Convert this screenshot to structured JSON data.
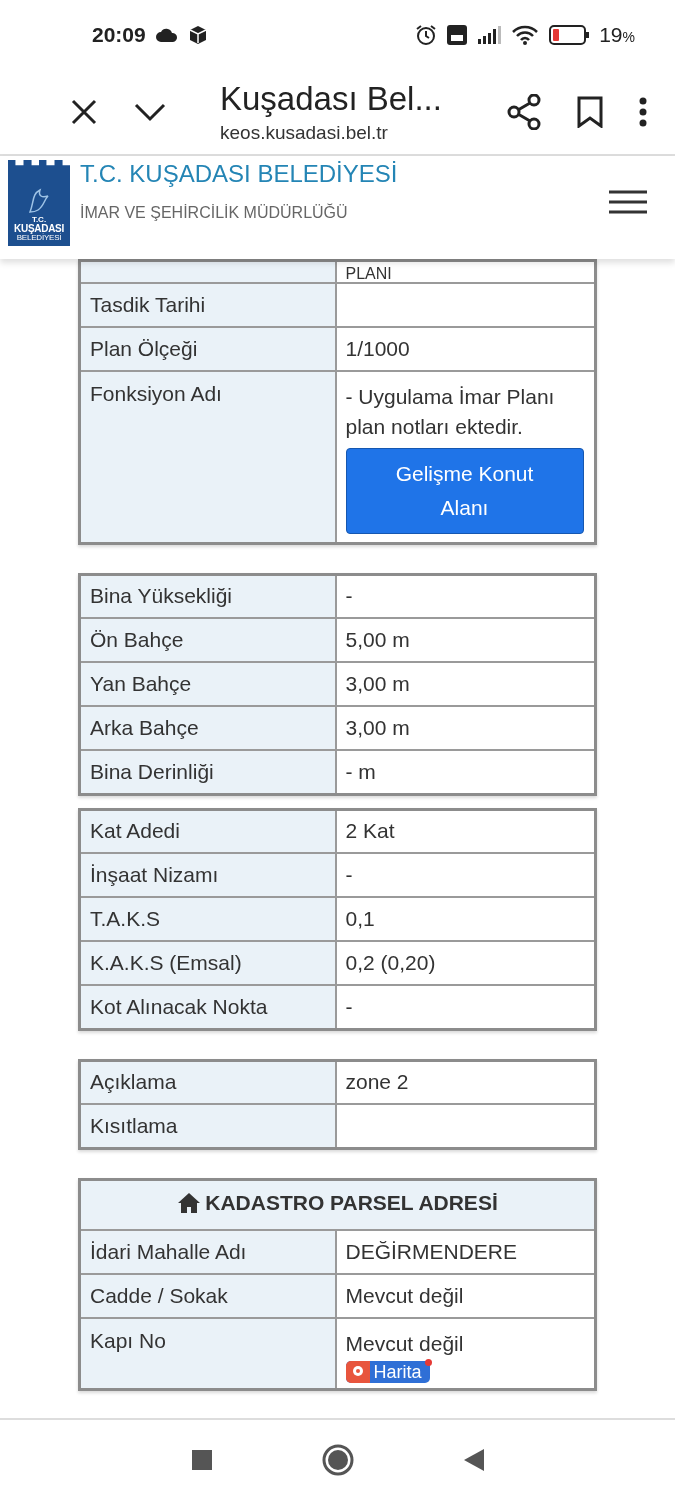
{
  "status_bar": {
    "time": "20:09",
    "battery": "19",
    "battery_unit": "%"
  },
  "browser": {
    "title": "Kuşadası Bel...",
    "url": "keos.kusadasi.bel.tr"
  },
  "site_header": {
    "logo": {
      "line_1": "T.C.",
      "line_2": "KUŞADASI",
      "line_3": "BELEDİYESİ"
    },
    "title": "T.C. KUŞADASI BELEDİYESİ",
    "subtitle": "İMAR VE ŞEHİRCİLİK MÜDÜRLÜĞÜ"
  },
  "tables": [
    {
      "rows": [
        {
          "kind": "partial",
          "label": "",
          "value": "PLANI"
        },
        {
          "label": "Tasdik Tarihi",
          "value": ""
        },
        {
          "label": "Plan Ölçeği",
          "value": "1/1000"
        },
        {
          "label": "Fonksiyon Adı",
          "value": "- Uygulama İmar Planı plan notları ektedir.",
          "button": {
            "kind": "function",
            "label": "Gelişme Konut Alanı"
          }
        }
      ]
    },
    {
      "rows": [
        {
          "label": "Bina Yüksekliği",
          "value": "-"
        },
        {
          "label": "Ön Bahçe",
          "value": "5,00 m"
        },
        {
          "label": "Yan Bahçe",
          "value": "3,00 m"
        },
        {
          "label": "Arka Bahçe",
          "value": "3,00 m"
        },
        {
          "label": "Bina Derinliği",
          "value": "- m"
        }
      ]
    },
    {
      "rows": [
        {
          "label": "Kat Adedi",
          "value": "2 Kat"
        },
        {
          "label": "İnşaat Nizamı",
          "value": "-"
        },
        {
          "label": "T.A.K.S",
          "value": "0,1"
        },
        {
          "label": "K.A.K.S (Emsal)",
          "value": "0,2 (0,20)"
        },
        {
          "label": "Kot Alınacak Nokta",
          "value": "-"
        }
      ]
    },
    {
      "rows": [
        {
          "label": "Açıklama",
          "value": "zone 2"
        },
        {
          "label": "Kısıtlama",
          "value": ""
        }
      ]
    },
    {
      "header": "KADASTRO PARSEL ADRESİ",
      "rows": [
        {
          "label": "İdari Mahalle Adı",
          "value": "DEĞİRMENDERE"
        },
        {
          "label": "Cadde / Sokak",
          "value": "Mevcut değil"
        },
        {
          "label": "Kapı No",
          "value": "Mevcut değil",
          "button": {
            "kind": "map",
            "label": "Harita"
          }
        }
      ]
    }
  ]
}
